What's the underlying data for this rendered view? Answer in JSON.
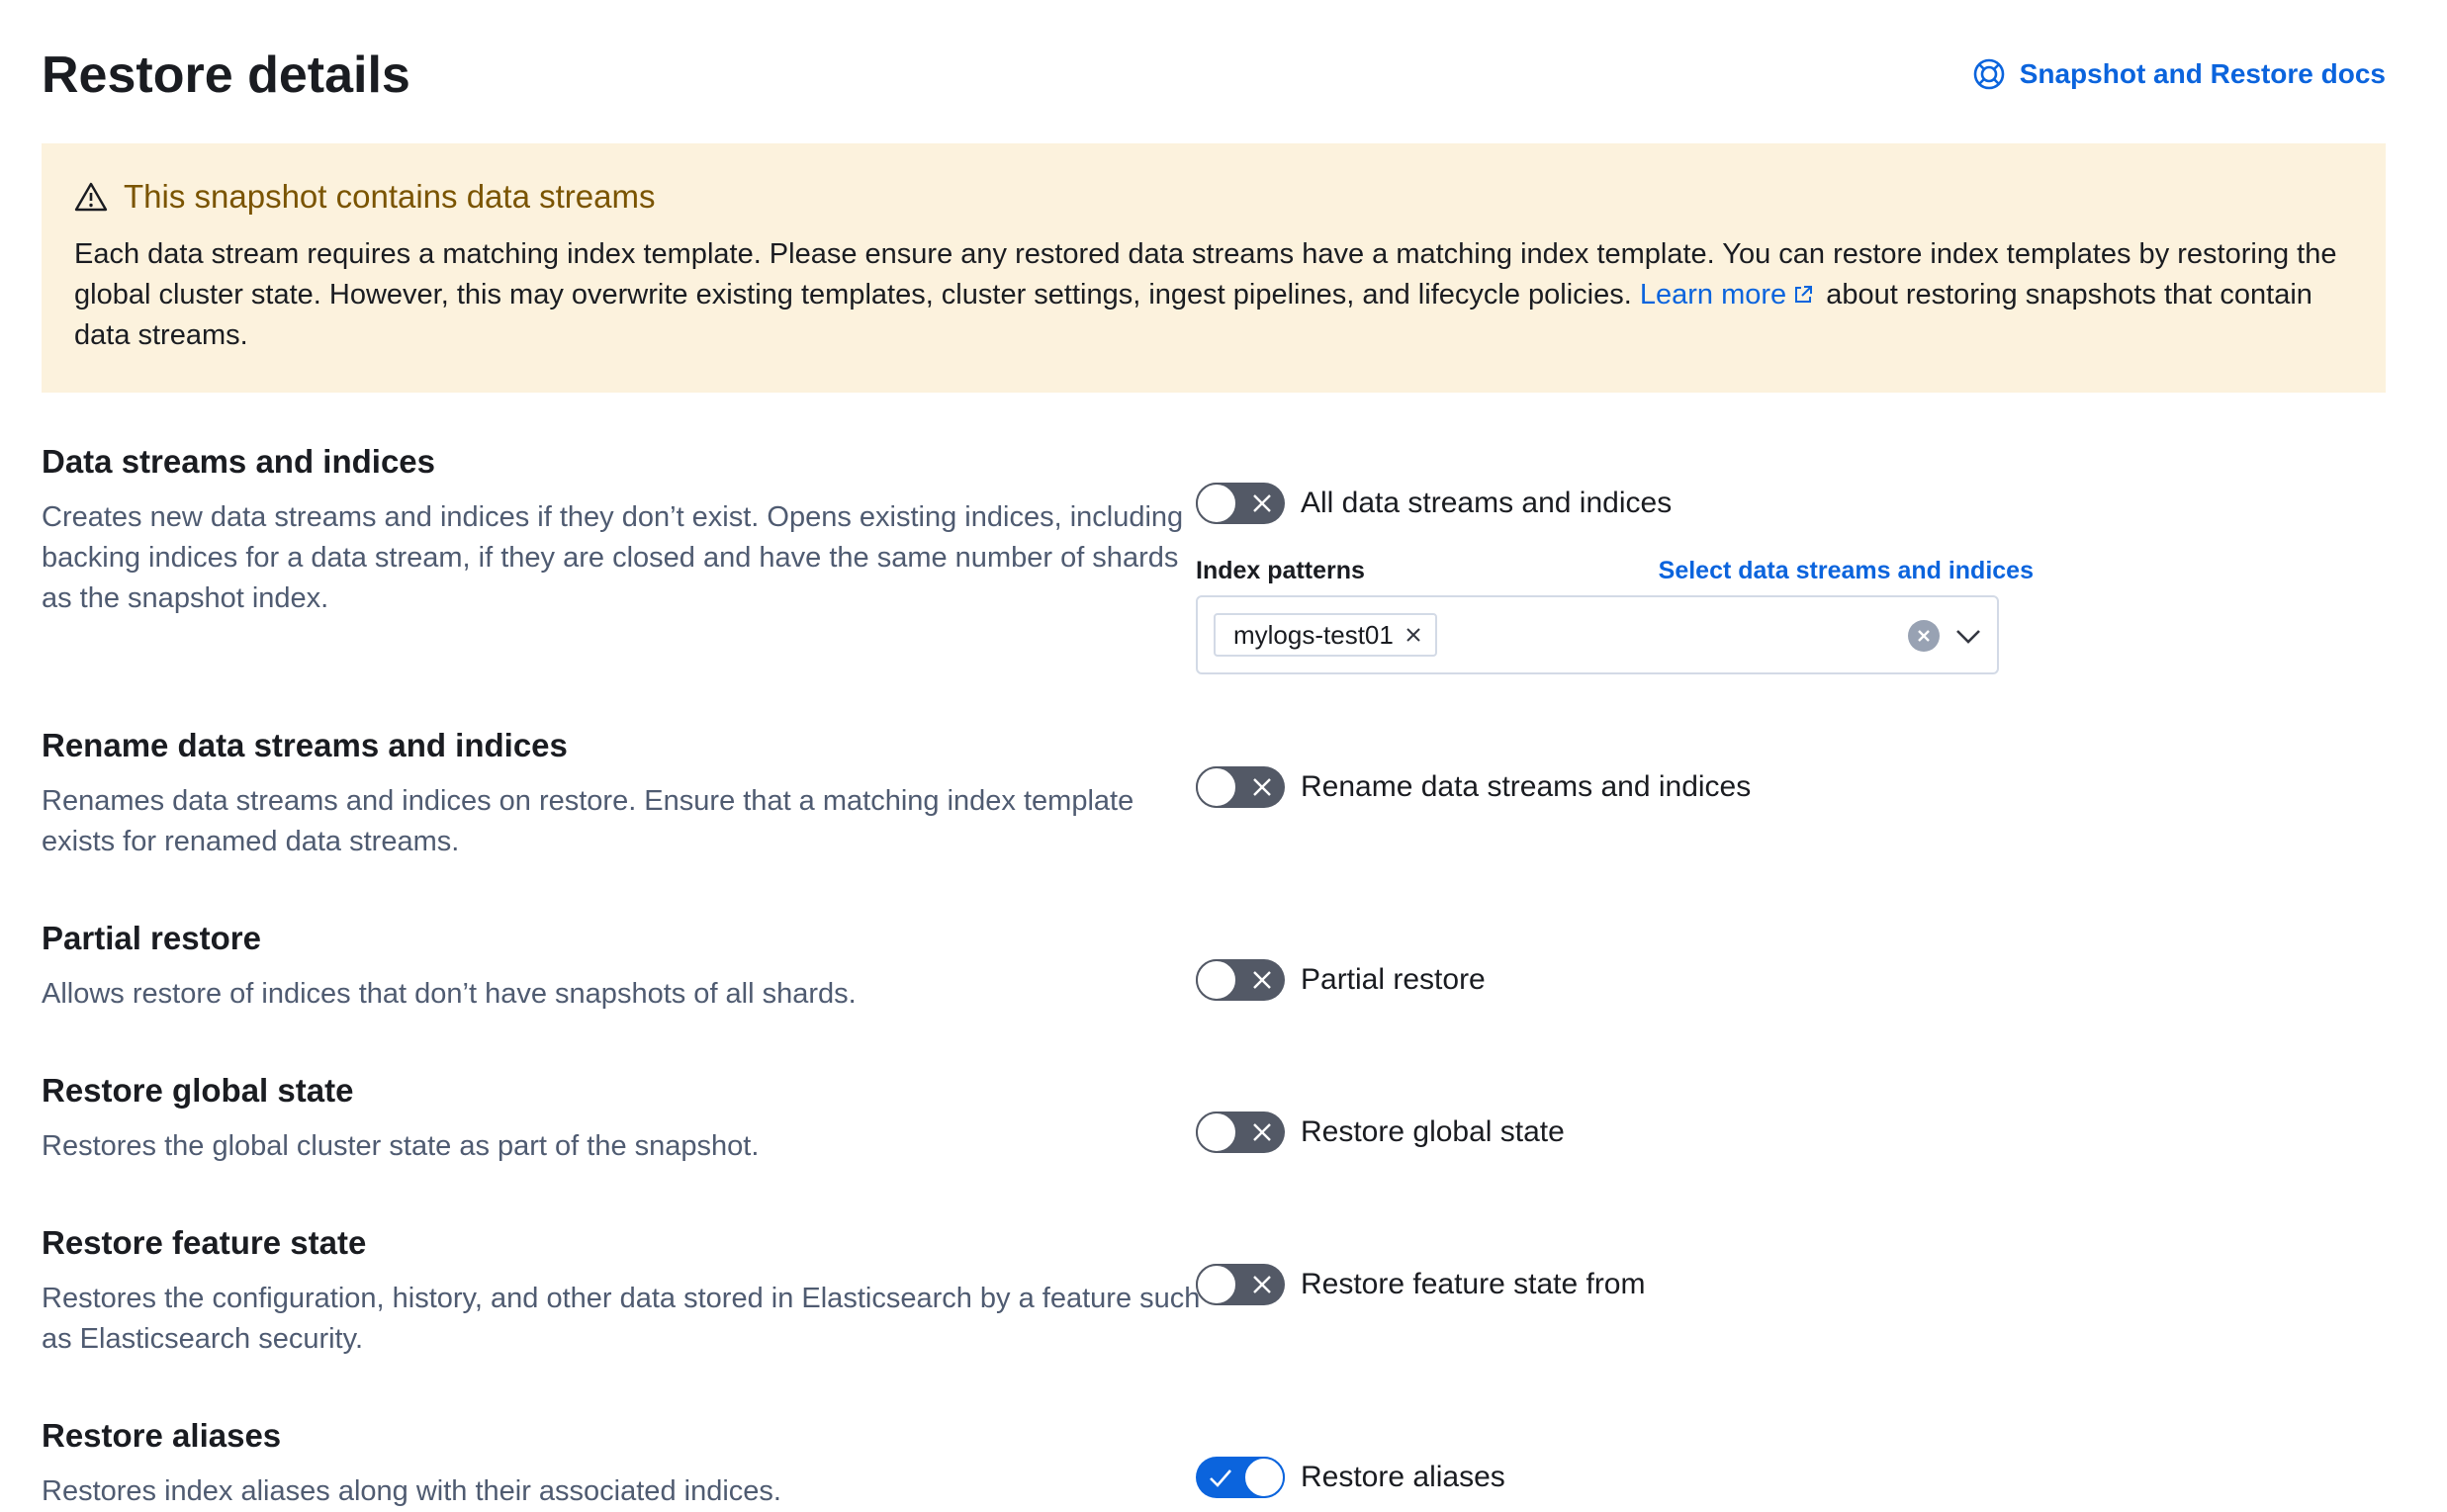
{
  "header": {
    "title": "Restore details",
    "docs_link": "Snapshot and Restore docs"
  },
  "callout": {
    "title": "This snapshot contains data streams",
    "body_before": "Each data stream requires a matching index template. Please ensure any restored data streams have a matching index template. You can restore index templates by restoring the global cluster state. However, this may overwrite existing templates, cluster settings, ingest pipelines, and lifecycle policies. ",
    "link": "Learn more",
    "body_after": " about restoring snapshots that contain data streams."
  },
  "sections": [
    {
      "title": "Data streams and indices",
      "description": "Creates new data streams and indices if they don’t exist. Opens existing indices, including backing indices for a data stream, if they are closed and have the same number of shards as the snapshot index.",
      "switch_label": "All data streams and indices",
      "checked": false
    },
    {
      "title": "Rename data streams and indices",
      "description": "Renames data streams and indices on restore. Ensure that a matching index template exists for renamed data streams.",
      "switch_label": "Rename data streams and indices",
      "checked": false
    },
    {
      "title": "Partial restore",
      "description": "Allows restore of indices that don’t have snapshots of all shards.",
      "switch_label": "Partial restore",
      "checked": false
    },
    {
      "title": "Restore global state",
      "description": "Restores the global cluster state as part of the snapshot.",
      "switch_label": "Restore global state",
      "checked": false
    },
    {
      "title": "Restore feature state",
      "description": "Restores the configuration, history, and other data stored in Elasticsearch by a feature such as Elasticsearch security.",
      "switch_label": "Restore feature state from",
      "checked": false
    },
    {
      "title": "Restore aliases",
      "description": "Restores index aliases along with their associated indices.",
      "switch_label": "Restore aliases",
      "checked": true
    }
  ],
  "index_patterns": {
    "label": "Index patterns",
    "select_link": "Select data streams and indices",
    "selected": [
      "mylogs-test01"
    ]
  },
  "colors": {
    "link": "#0b64dd",
    "warning_bg": "#fcf2dd",
    "warning_text": "#7a5400",
    "switch_off": "#535966",
    "switch_on": "#0b64dd"
  },
  "icons": [
    "help-icon",
    "warning-icon",
    "external-link-icon",
    "cross-icon",
    "check-icon",
    "clear-icon",
    "chevron-down-icon"
  ]
}
